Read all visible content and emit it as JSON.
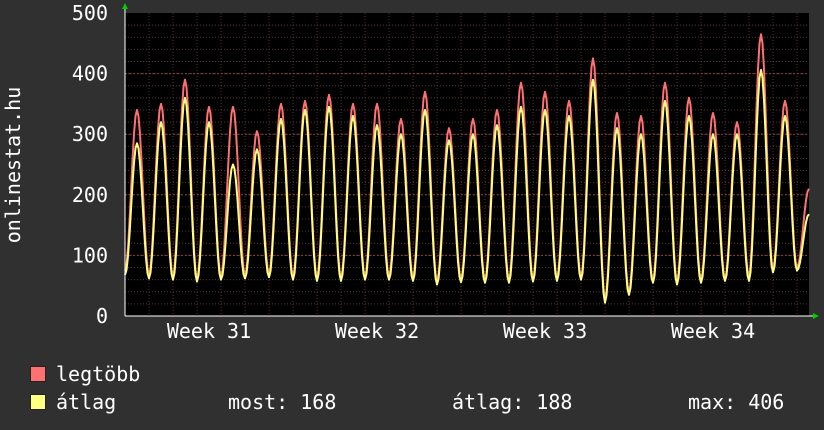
{
  "chart_data": {
    "type": "line",
    "ylabel": "onlinestat.hu",
    "ylim": [
      0,
      500
    ],
    "y_ticks": [
      "0",
      "100",
      "200",
      "300",
      "400",
      "500"
    ],
    "x_ticks": [
      "Week 31",
      "Week 32",
      "Week 33",
      "Week 34"
    ],
    "x_range_days": [
      0,
      28.5
    ],
    "grid": true,
    "legend_position": "bottom-left",
    "series": [
      {
        "name": "legtöbb",
        "color": "#ff7070",
        "daily": [
          {
            "day": 0,
            "min": 75,
            "peak": 340
          },
          {
            "day": 1,
            "min": 68,
            "peak": 350
          },
          {
            "day": 2,
            "min": 66,
            "peak": 390
          },
          {
            "day": 3,
            "min": 62,
            "peak": 345
          },
          {
            "day": 4,
            "min": 65,
            "peak": 345
          },
          {
            "day": 5,
            "min": 68,
            "peak": 305
          },
          {
            "day": 6,
            "min": 70,
            "peak": 350
          },
          {
            "day": 7,
            "min": 66,
            "peak": 355
          },
          {
            "day": 8,
            "min": 64,
            "peak": 365
          },
          {
            "day": 9,
            "min": 63,
            "peak": 350
          },
          {
            "day": 10,
            "min": 65,
            "peak": 350
          },
          {
            "day": 11,
            "min": 66,
            "peak": 325
          },
          {
            "day": 12,
            "min": 64,
            "peak": 370
          },
          {
            "day": 13,
            "min": 58,
            "peak": 310
          },
          {
            "day": 14,
            "min": 62,
            "peak": 325
          },
          {
            "day": 15,
            "min": 60,
            "peak": 340
          },
          {
            "day": 16,
            "min": 60,
            "peak": 385
          },
          {
            "day": 17,
            "min": 62,
            "peak": 370
          },
          {
            "day": 18,
            "min": 63,
            "peak": 355
          },
          {
            "day": 19,
            "min": 65,
            "peak": 425
          },
          {
            "day": 20,
            "min": 28,
            "peak": 335
          },
          {
            "day": 21,
            "min": 40,
            "peak": 330
          },
          {
            "day": 22,
            "min": 60,
            "peak": 385
          },
          {
            "day": 23,
            "min": 58,
            "peak": 360
          },
          {
            "day": 24,
            "min": 60,
            "peak": 335
          },
          {
            "day": 25,
            "min": 62,
            "peak": 320
          },
          {
            "day": 26,
            "min": 65,
            "peak": 465
          },
          {
            "day": 27,
            "min": 78,
            "peak": 355
          },
          {
            "day": 28,
            "min": 80,
            "peak": 210
          }
        ]
      },
      {
        "name": "átlag",
        "color": "#ffff80",
        "daily": [
          {
            "day": 0,
            "min": 68,
            "peak": 285
          },
          {
            "day": 1,
            "min": 62,
            "peak": 320
          },
          {
            "day": 2,
            "min": 60,
            "peak": 360
          },
          {
            "day": 3,
            "min": 57,
            "peak": 320
          },
          {
            "day": 4,
            "min": 60,
            "peak": 250
          },
          {
            "day": 5,
            "min": 62,
            "peak": 275
          },
          {
            "day": 6,
            "min": 64,
            "peak": 325
          },
          {
            "day": 7,
            "min": 60,
            "peak": 340
          },
          {
            "day": 8,
            "min": 58,
            "peak": 345
          },
          {
            "day": 9,
            "min": 58,
            "peak": 330
          },
          {
            "day": 10,
            "min": 60,
            "peak": 315
          },
          {
            "day": 11,
            "min": 60,
            "peak": 300
          },
          {
            "day": 12,
            "min": 58,
            "peak": 340
          },
          {
            "day": 13,
            "min": 52,
            "peak": 290
          },
          {
            "day": 14,
            "min": 56,
            "peak": 300
          },
          {
            "day": 15,
            "min": 55,
            "peak": 315
          },
          {
            "day": 16,
            "min": 55,
            "peak": 345
          },
          {
            "day": 17,
            "min": 57,
            "peak": 340
          },
          {
            "day": 18,
            "min": 58,
            "peak": 330
          },
          {
            "day": 19,
            "min": 60,
            "peak": 390
          },
          {
            "day": 20,
            "min": 22,
            "peak": 310
          },
          {
            "day": 21,
            "min": 35,
            "peak": 300
          },
          {
            "day": 22,
            "min": 55,
            "peak": 355
          },
          {
            "day": 23,
            "min": 52,
            "peak": 330
          },
          {
            "day": 24,
            "min": 55,
            "peak": 300
          },
          {
            "day": 25,
            "min": 58,
            "peak": 300
          },
          {
            "day": 26,
            "min": 58,
            "peak": 406
          },
          {
            "day": 27,
            "min": 72,
            "peak": 330
          },
          {
            "day": 28,
            "min": 75,
            "peak": 168
          }
        ]
      }
    ]
  },
  "legend": {
    "max_label": "legtöbb",
    "avg_label": "átlag",
    "max_color": "#ff7070",
    "avg_color": "#ffff80"
  },
  "stats": {
    "now": "most: 168",
    "avg": "átlag: 188",
    "max": "max: 406"
  }
}
